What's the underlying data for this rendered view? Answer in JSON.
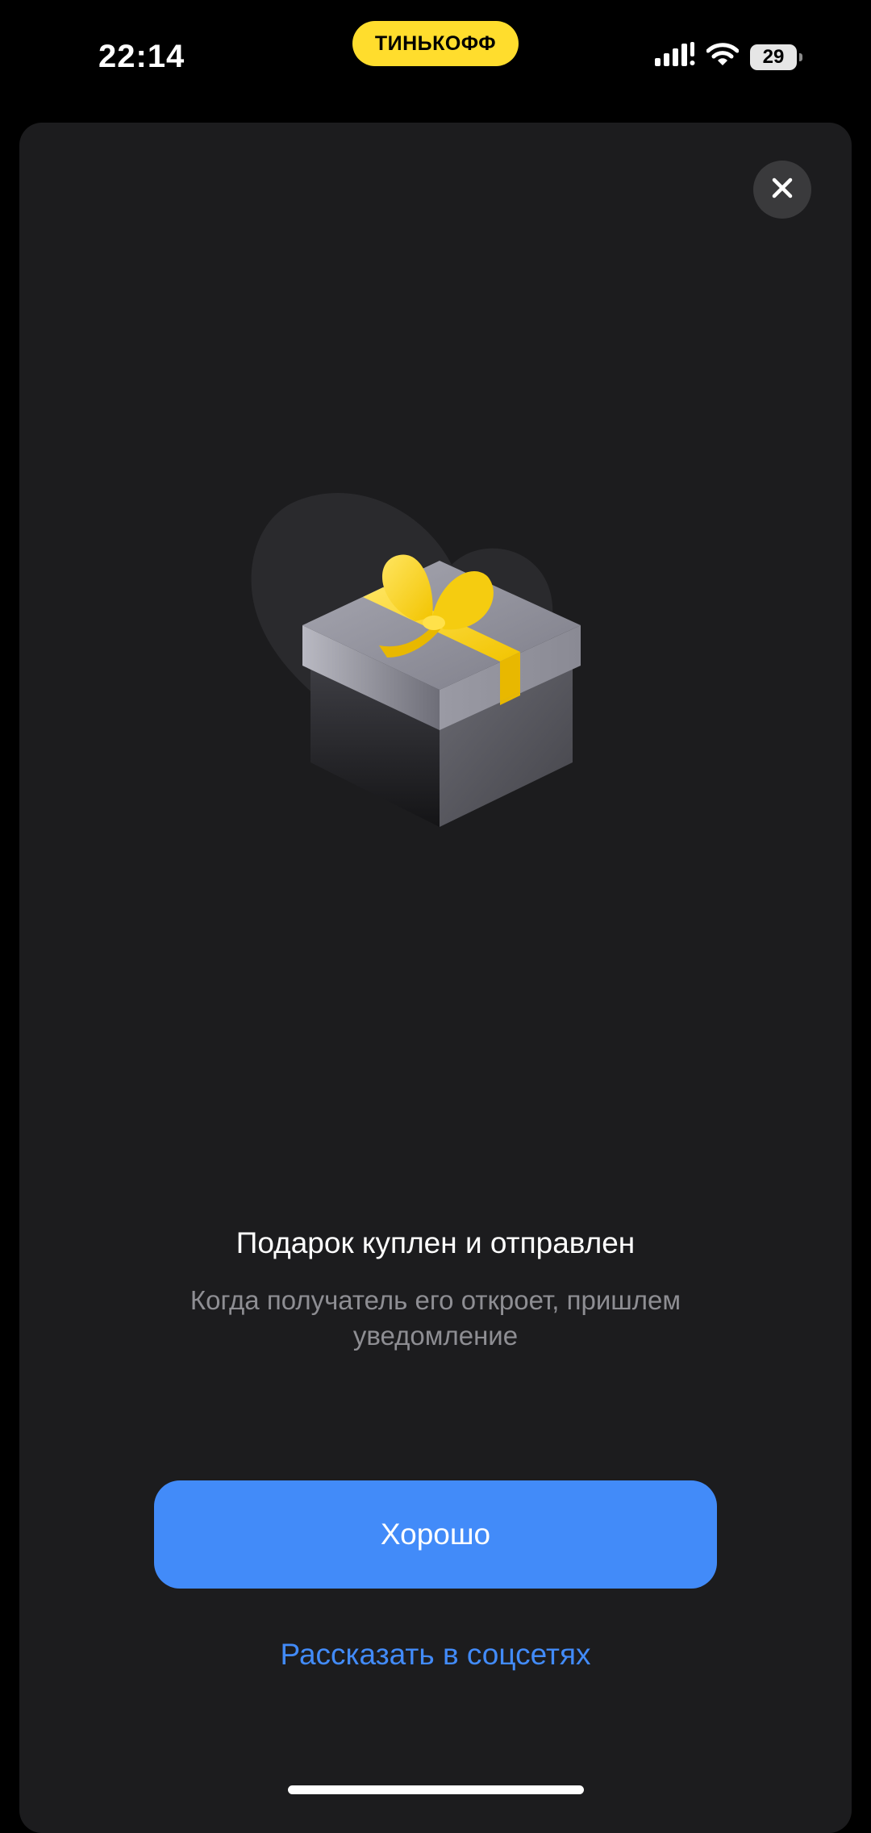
{
  "status_bar": {
    "time": "22:14",
    "brand": "ТИНЬКОФФ",
    "battery": "29",
    "icons": [
      "signal-icon",
      "wifi-icon",
      "battery-icon"
    ]
  },
  "dialog": {
    "close_icon": "close-icon",
    "illustration": "gift-box-illustration",
    "title": "Подарок куплен и отправлен",
    "subtitle": "Когда получатель его откроет, пришлем уведомление",
    "primary_button": "Хорошо",
    "share_link": "Рассказать в соцсетях"
  },
  "colors": {
    "background": "#000000",
    "sheet": "#1c1c1e",
    "accent_blue": "#428BF9",
    "brand_yellow": "#FFDD2D",
    "secondary_text": "#8e8e93",
    "close_button_bg": "#3a3a3c"
  }
}
